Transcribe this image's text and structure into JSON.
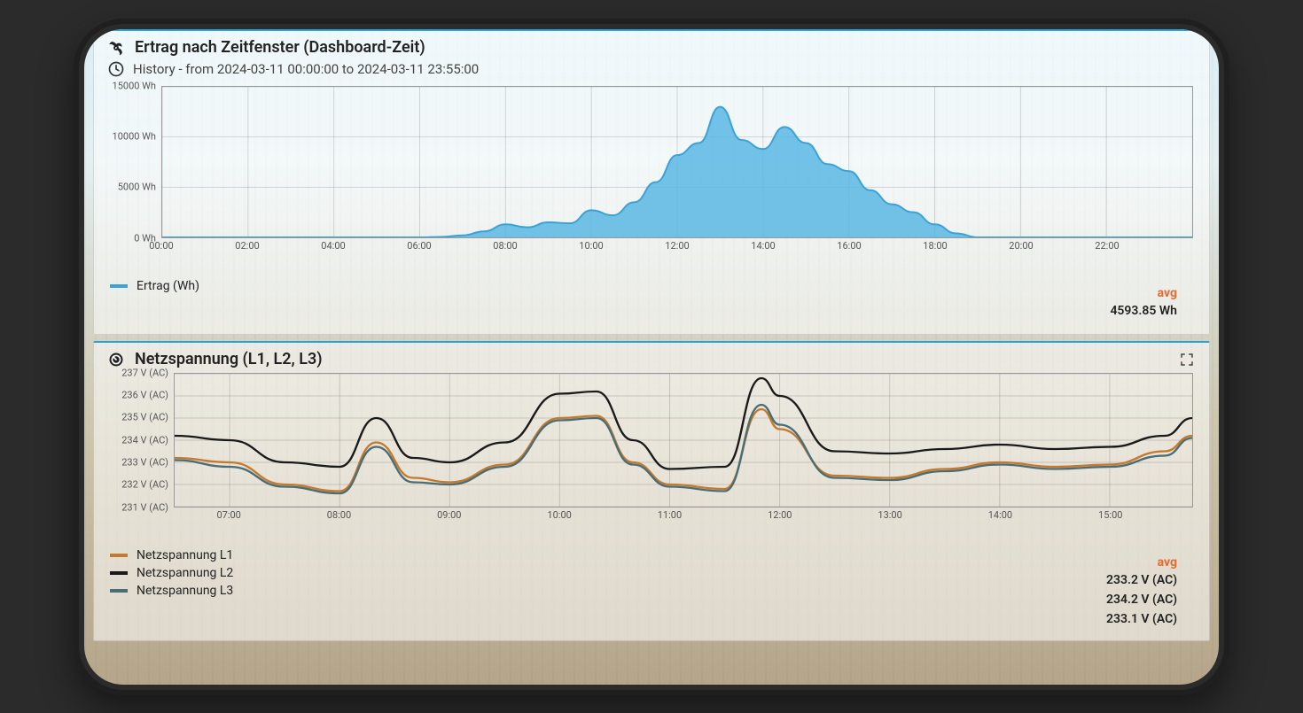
{
  "panel1": {
    "title": "Ertrag nach Zeitfenster (Dashboard-Zeit)",
    "subtitle": "History - from 2024-03-11 00:00:00 to 2024-03-11 23:55:00",
    "avg_label": "avg",
    "legend": "Ertrag (Wh)",
    "avg_value": "4593.85 Wh"
  },
  "panel2": {
    "title": "Netzspannung (L1, L2, L3)",
    "avg_label": "avg",
    "legend_l1": "Netzspannung L1",
    "legend_l2": "Netzspannung L2",
    "legend_l3": "Netzspannung L3",
    "avg_l1": "233.2 V (AC)",
    "avg_l2": "234.2 V (AC)",
    "avg_l3": "233.1 V (AC)"
  },
  "colors": {
    "ertrag_fill": "#5ab7e4",
    "ertrag_stroke": "#3ca1d6",
    "l1": "#c5792d",
    "l2": "#1a1a1a",
    "l3": "#4a6d75"
  },
  "chart_data": [
    {
      "type": "area",
      "title": "Ertrag nach Zeitfenster (Dashboard-Zeit)",
      "xlabel": "",
      "ylabel": "Wh",
      "ylim": [
        0,
        15000
      ],
      "yticks": [
        0,
        5000,
        10000,
        15000
      ],
      "ytick_labels": [
        "0 Wh",
        "5000 Wh",
        "10000 Wh",
        "15000 Wh"
      ],
      "xticks": [
        "00:00",
        "02:00",
        "04:00",
        "06:00",
        "08:00",
        "10:00",
        "12:00",
        "14:00",
        "16:00",
        "18:00",
        "20:00",
        "22:00"
      ],
      "x": [
        "00:00",
        "01:00",
        "02:00",
        "03:00",
        "04:00",
        "05:00",
        "06:00",
        "06:30",
        "07:00",
        "07:30",
        "08:00",
        "08:30",
        "09:00",
        "09:30",
        "10:00",
        "10:30",
        "11:00",
        "11:30",
        "12:00",
        "12:30",
        "13:00",
        "13:30",
        "14:00",
        "14:30",
        "15:00",
        "15:30",
        "16:00",
        "16:30",
        "17:00",
        "17:30",
        "18:00",
        "18:30",
        "19:00",
        "20:00",
        "21:00",
        "22:00",
        "23:00",
        "24:00"
      ],
      "series": [
        {
          "name": "Ertrag (Wh)",
          "values": [
            0,
            0,
            0,
            0,
            0,
            0,
            0,
            50,
            200,
            600,
            1300,
            1000,
            1500,
            1400,
            2700,
            2200,
            3500,
            5500,
            8200,
            9400,
            13000,
            9700,
            8800,
            11000,
            9400,
            7300,
            6600,
            4700,
            3300,
            2500,
            1300,
            400,
            0,
            0,
            0,
            0,
            0,
            0
          ]
        }
      ]
    },
    {
      "type": "line",
      "title": "Netzspannung (L1, L2, L3)",
      "xlabel": "",
      "ylabel": "V (AC)",
      "ylim": [
        231,
        237
      ],
      "yticks": [
        231,
        232,
        233,
        234,
        235,
        236,
        237
      ],
      "ytick_labels": [
        "231 V (AC)",
        "232 V (AC)",
        "233 V (AC)",
        "234 V (AC)",
        "235 V (AC)",
        "236 V (AC)",
        "237 V (AC)"
      ],
      "xticks": [
        "07:00",
        "08:00",
        "09:00",
        "10:00",
        "11:00",
        "12:00",
        "13:00",
        "14:00",
        "15:00"
      ],
      "x": [
        "06:30",
        "07:00",
        "07:30",
        "08:00",
        "08:20",
        "08:40",
        "09:00",
        "09:30",
        "10:00",
        "10:20",
        "10:40",
        "11:00",
        "11:30",
        "11:50",
        "12:00",
        "12:30",
        "13:00",
        "13:30",
        "14:00",
        "14:30",
        "15:00",
        "15:30",
        "15:45"
      ],
      "series": [
        {
          "name": "Netzspannung L1",
          "values": [
            233.2,
            233.0,
            232.0,
            231.7,
            233.9,
            232.3,
            232.1,
            232.9,
            235.0,
            235.1,
            233.0,
            232.0,
            231.8,
            235.4,
            234.5,
            232.4,
            232.3,
            232.7,
            233.0,
            232.8,
            232.9,
            233.5,
            234.2
          ]
        },
        {
          "name": "Netzspannung L2",
          "values": [
            234.2,
            234.0,
            233.0,
            232.8,
            235.0,
            233.2,
            233.0,
            233.9,
            236.1,
            236.2,
            234.0,
            232.7,
            232.8,
            236.8,
            236.0,
            233.5,
            233.4,
            233.6,
            233.8,
            233.6,
            233.7,
            234.2,
            235.0
          ]
        },
        {
          "name": "Netzspannung L3",
          "values": [
            233.1,
            232.8,
            231.9,
            231.6,
            233.7,
            232.1,
            232.0,
            232.8,
            234.9,
            235.0,
            232.9,
            231.9,
            231.7,
            235.6,
            234.7,
            232.3,
            232.2,
            232.6,
            232.9,
            232.7,
            232.8,
            233.3,
            234.1
          ]
        }
      ]
    }
  ]
}
